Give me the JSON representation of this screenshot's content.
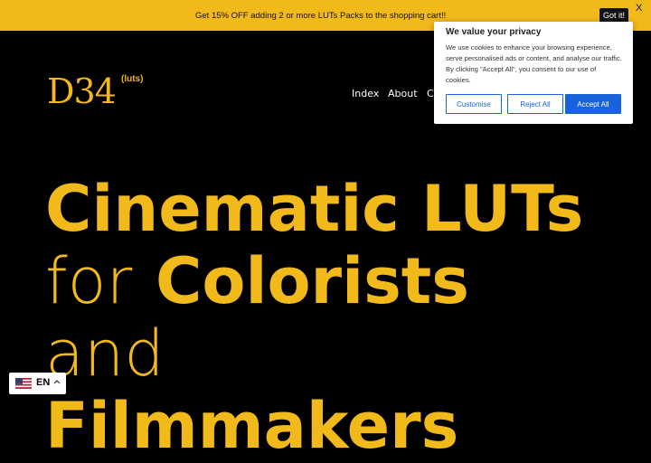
{
  "promo": {
    "text": "Get 15% OFF adding 2 or more LUTs Packs to the shopping cart!!",
    "button": "Got it!",
    "close": "X"
  },
  "logo": {
    "main": "D34",
    "sup": "(luts)"
  },
  "nav": {
    "items": [
      "Index",
      "About",
      "C"
    ]
  },
  "hero": {
    "line1": "Cinematic LUTs",
    "line2_light": "for",
    "line2_bold": "Colorists",
    "line3": "and",
    "line4": "Filmmakers"
  },
  "cookie": {
    "title": "We value your privacy",
    "body": "We use cookies to enhance your browsing experience, serve personalised ads or content, and analyse our traffic. By clicking \"Accept All\", you consent to our use of cookies.",
    "customise": "Customise",
    "reject": "Reject All",
    "accept": "Accept All"
  },
  "language": {
    "code": "EN",
    "flag_icon": "us-flag-icon",
    "caret_icon": "chevron-up-icon"
  },
  "colors": {
    "accent": "#f2b91b",
    "background": "#000000",
    "cookie_blue": "#1863dc"
  }
}
